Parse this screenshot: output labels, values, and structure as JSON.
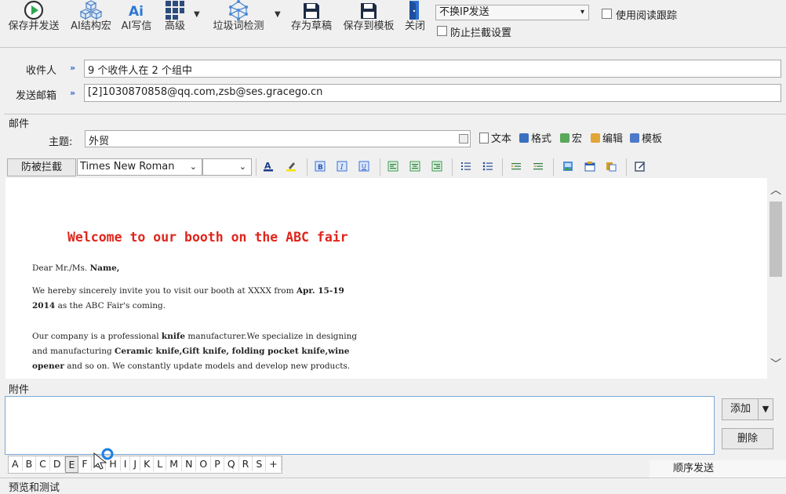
{
  "toolbar": {
    "save_send": "保存并发送",
    "ai_structure": "AI结构宏",
    "ai_write": "AI写信",
    "advanced": "高级",
    "spam_check": "垃圾词检测",
    "save_draft": "存为草稿",
    "save_template": "保存到模板",
    "close": "关闭",
    "ip_option": "不换IP发送",
    "read_tracking": "使用阅读跟踪",
    "anti_block": "防止拦截设置"
  },
  "recipients": {
    "to_label": "收件人",
    "to_value": "9 个收件人在 2 个组中",
    "from_label": "发送邮箱",
    "from_value": "[2]1030870858@qq.com,zsb@ses.gracego.cn"
  },
  "mail": {
    "section_label": "邮件",
    "subject_label": "主题:",
    "subject_value": "外贸",
    "text_btn": "文本",
    "format_btn": "格式",
    "macro_btn": "宏",
    "edit_btn": "编辑",
    "template_btn": "模板"
  },
  "format": {
    "anti_block_btn": "防被拦截",
    "font": "Times New Roman",
    "size": ""
  },
  "editor": {
    "title": "Welcome to our booth on the ABC fair",
    "lines": [
      [
        "Dear Mr./Ms. ",
        "Name,"
      ],
      [
        "We hereby sincerely invite you to visit our booth at XXXX from ",
        "Apr. 15-19"
      ],
      [
        "2014",
        " as the ABC Fair's coming."
      ],
      [
        "Our company is a professional ",
        "knife",
        " manufacturer.We specialize in designing"
      ],
      [
        "and manufacturing ",
        "Ceramic knife,Gift knife, folding pocket knife,wine"
      ],
      [
        "opener",
        " and so on. We constantly update models and develop new products."
      ]
    ]
  },
  "attachments": {
    "label": "附件",
    "add": "添加",
    "delete": "删除",
    "sequential": "顺序发送",
    "letters": [
      "A",
      "B",
      "C",
      "D",
      "E",
      "F",
      "G",
      "H",
      "I",
      "J",
      "K",
      "L",
      "M",
      "N",
      "O",
      "P",
      "Q",
      "R",
      "S",
      "+"
    ]
  },
  "preview": {
    "label": "预览和测试"
  }
}
